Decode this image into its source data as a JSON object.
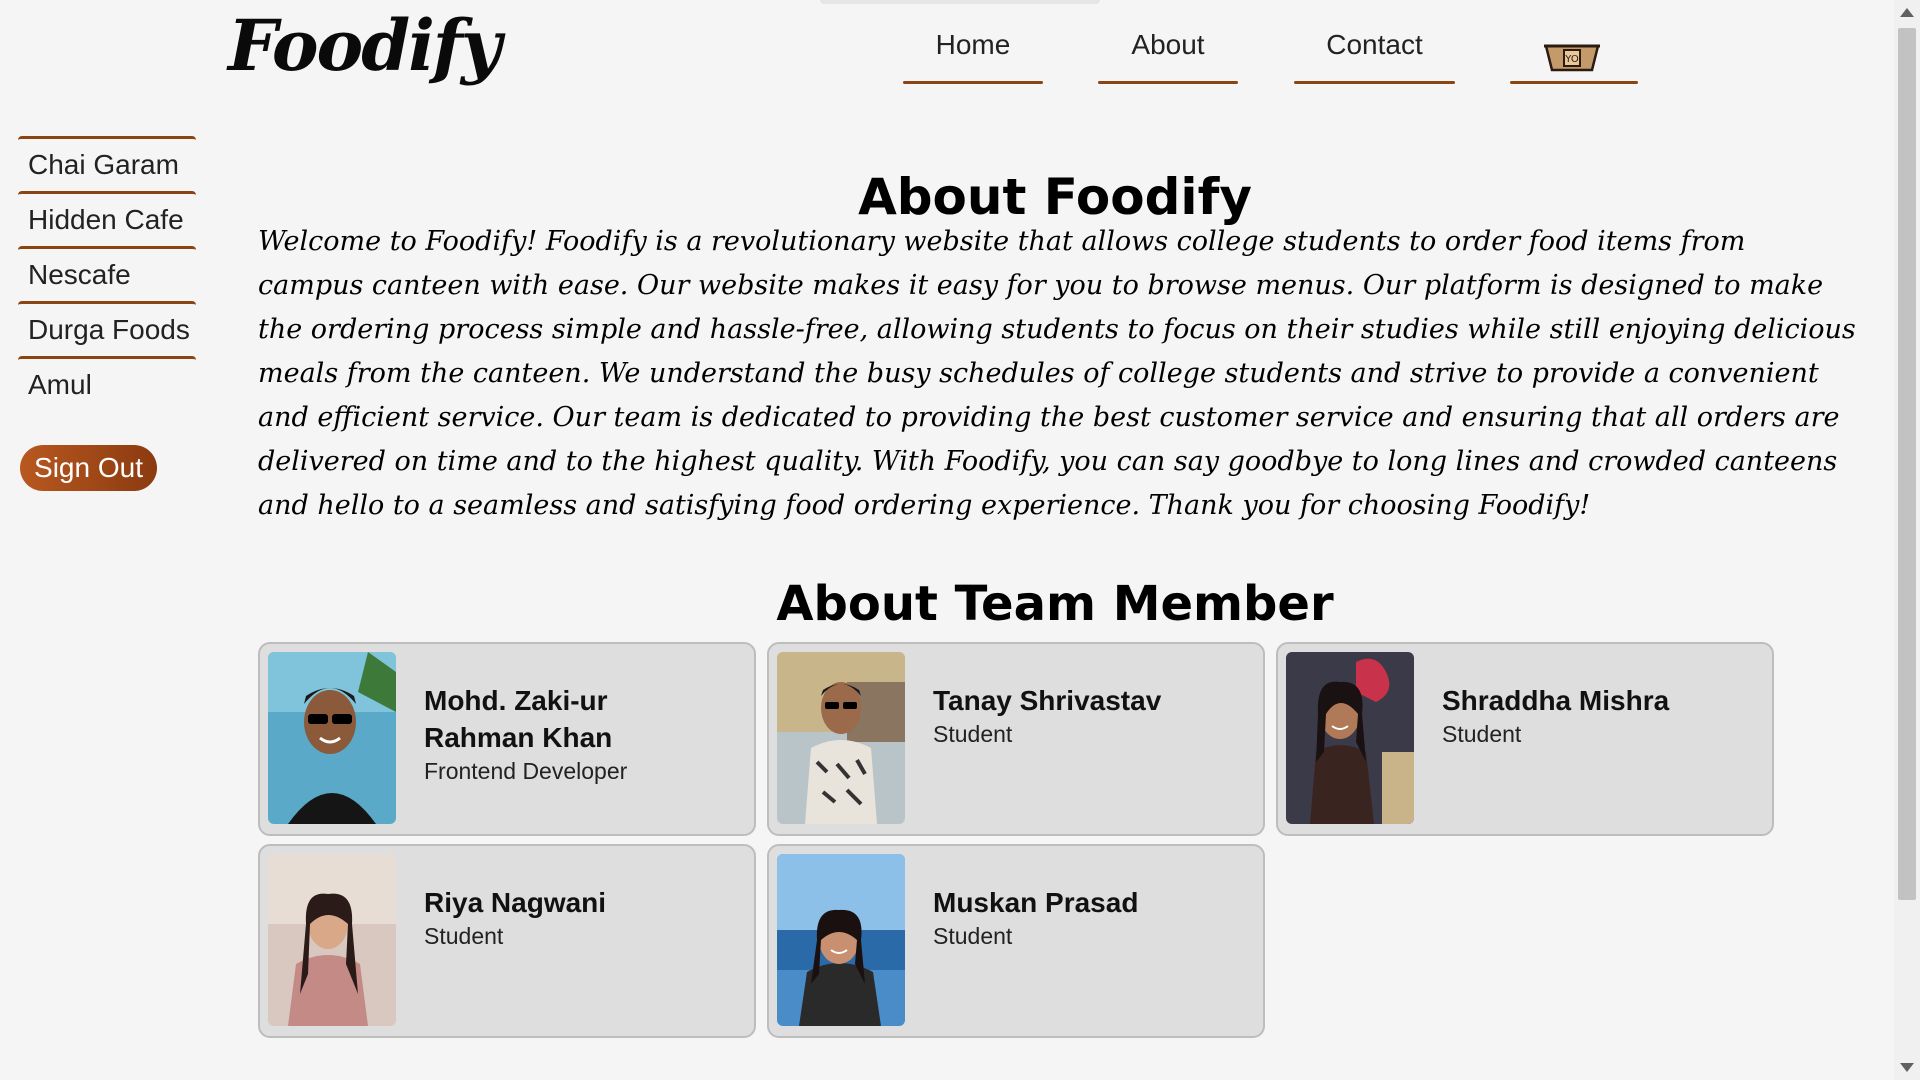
{
  "brand": {
    "logo_text": "Foodify"
  },
  "nav": {
    "items": [
      {
        "label": "Home"
      },
      {
        "label": "About"
      },
      {
        "label": "Contact"
      }
    ],
    "cart_icon": "food-box-icon"
  },
  "sidebar": {
    "items": [
      {
        "label": "Chai Garam"
      },
      {
        "label": "Hidden Cafe"
      },
      {
        "label": "Nescafe"
      },
      {
        "label": "Durga Foods"
      },
      {
        "label": "Amul"
      }
    ],
    "signout_label": "Sign Out"
  },
  "about": {
    "title": "About Foodify",
    "text": "Welcome to Foodify! Foodify is a revolutionary website that allows college students to order food items from campus canteen with ease. Our website makes it easy for you to browse menus. Our platform is designed to make the ordering process simple and hassle-free, allowing students to focus on their studies while still enjoying delicious meals from the canteen. We understand the busy schedules of college students and strive to provide a convenient and efficient service. Our team is dedicated to providing the best customer service and ensuring that all orders are delivered on time and to the highest quality. With Foodify, you can say goodbye to long lines and crowded canteens and hello to a seamless and satisfying food ordering experience. Thank you for choosing Foodify!"
  },
  "team": {
    "title": "About Team Member",
    "members": [
      {
        "name": "Mohd. Zaki-ur Rahman Khan",
        "role": "Frontend Developer"
      },
      {
        "name": "Tanay Shrivastav",
        "role": "Student"
      },
      {
        "name": "Shraddha Mishra",
        "role": "Student"
      },
      {
        "name": "Riya Nagwani",
        "role": "Student"
      },
      {
        "name": "Muskan Prasad",
        "role": "Student"
      }
    ]
  },
  "colors": {
    "accent": "#8b4513",
    "signout_start": "#b8581f",
    "signout_end": "#8b3a10",
    "card_bg": "#dedede",
    "page_bg": "#f5f5f5"
  }
}
